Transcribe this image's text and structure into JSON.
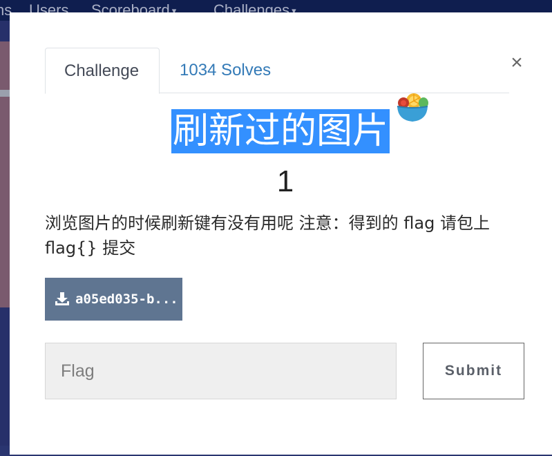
{
  "navbar": {
    "items": [
      "ns",
      "Users",
      "Scoreboard",
      "Challenges"
    ],
    "caret": "▾"
  },
  "modal": {
    "close_label": "×",
    "tabs": [
      {
        "label": "Challenge",
        "active": true
      },
      {
        "label": "1034 Solves",
        "active": false
      }
    ],
    "challenge_name": "刷新过的图片",
    "points": "1",
    "description_line1": "浏览图片的时候刷新键有没有用呢 注意：得到的 flag 请包上",
    "description_line2": "flag{} 提交",
    "file_label": "a05ed035-b...",
    "flag_input": {
      "value": "",
      "placeholder": "Flag"
    },
    "submit_label": "Submit"
  },
  "colors": {
    "selection_highlight": "#3390ff",
    "file_button": "#5f7591",
    "link": "#337ab7"
  }
}
